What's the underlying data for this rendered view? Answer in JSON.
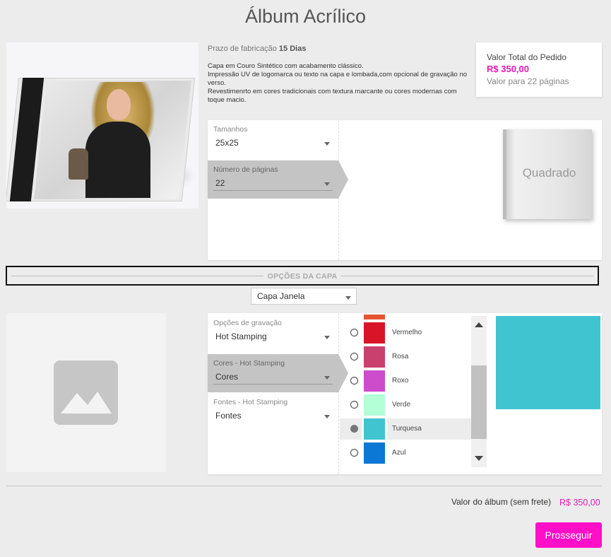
{
  "page": {
    "title": "Álbum Acrílico"
  },
  "product": {
    "lead_time_label": "Prazo de fabricação",
    "lead_time_value": "15 Dias",
    "description_lines": [
      "Capa em Couro Sintético com acabamento clássico.",
      "Impressão UV de logomarca ou texto na capa e lombada,com opcional de gravação no verso.",
      "Revestimenrto em cores tradicionais com textura marcante ou cores modernas com toque macio."
    ]
  },
  "order_total": {
    "label": "Valor Total do Pedido",
    "price": "R$ 350,00",
    "pages_note": "Valor para 22 páginas"
  },
  "config": {
    "size": {
      "label": "Tamanhos",
      "value": "25x25"
    },
    "pages": {
      "label": "Número de páginas",
      "value": "22"
    },
    "format_preview": "Quadrado"
  },
  "cover_section": {
    "title": "OPÇÕES DA CAPA",
    "cover_type": "Capa Janela",
    "engraving": {
      "label": "Opções de gravação",
      "value": "Hot Stamping"
    },
    "colors_field": {
      "label": "Cores - Hot Stamping",
      "value": "Cores"
    },
    "fonts_field": {
      "label": "Fontes - Hot Stamping",
      "value": "Fontes"
    },
    "colors": [
      {
        "name": "Vermelho",
        "hex": "#d91428",
        "selected": false
      },
      {
        "name": "Rosa",
        "hex": "#c9406f",
        "selected": false
      },
      {
        "name": "Roxo",
        "hex": "#cc4ccc",
        "selected": false
      },
      {
        "name": "Verde",
        "hex": "#b3ffd6",
        "selected": false
      },
      {
        "name": "Turquesa",
        "hex": "#40c4d0",
        "selected": true
      },
      {
        "name": "Azul",
        "hex": "#0a78d4",
        "selected": false
      }
    ],
    "partial_top_color": "#e5562e",
    "selected_color_hex": "#40c4d0"
  },
  "footer": {
    "album_value_label": "Valor do álbum (sem frete)",
    "album_value_price": "R$ 350,00",
    "continue_label": "Prosseguir"
  },
  "colors": {
    "accent": "#e41ab6",
    "button": "#ff0fc8"
  }
}
